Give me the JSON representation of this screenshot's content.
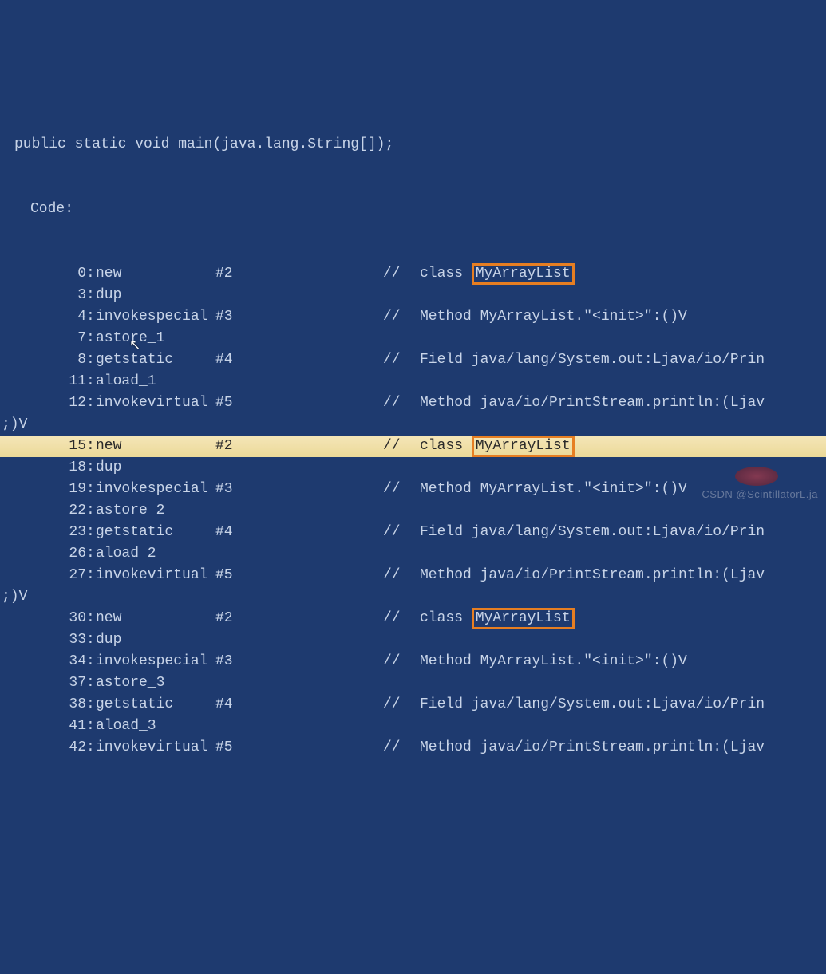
{
  "header": "public static void main(java.lang.String[]);",
  "code_label": "Code:",
  "edge_marker": ";)V",
  "watermark": "CSDN @ScintillatorL.ja",
  "lines": [
    {
      "pre": "",
      "offset": "0",
      "instr": "new",
      "arg": "#2",
      "sep": "//",
      "comment_prefix": "class ",
      "boxed": "MyArrayList",
      "comment_suffix": "",
      "hl": false
    },
    {
      "pre": "",
      "offset": "3",
      "instr": "dup",
      "arg": "",
      "sep": "",
      "comment_prefix": "",
      "boxed": "",
      "comment_suffix": "",
      "hl": false
    },
    {
      "pre": "",
      "offset": "4",
      "instr": "invokespecial",
      "arg": "#3",
      "sep": "//",
      "comment_prefix": "Method MyArrayList.\"<init>\":()V",
      "boxed": "",
      "comment_suffix": "",
      "hl": false
    },
    {
      "pre": "",
      "offset": "7",
      "instr": "astore_1",
      "arg": "",
      "sep": "",
      "comment_prefix": "",
      "boxed": "",
      "comment_suffix": "",
      "hl": false
    },
    {
      "pre": "",
      "offset": "8",
      "instr": "getstatic",
      "arg": "#4",
      "sep": "//",
      "comment_prefix": "Field java/lang/System.out:Ljava/io/Prin",
      "boxed": "",
      "comment_suffix": "",
      "hl": false
    },
    {
      "pre": "",
      "offset": "11",
      "instr": "aload_1",
      "arg": "",
      "sep": "",
      "comment_prefix": "",
      "boxed": "",
      "comment_suffix": "",
      "hl": false
    },
    {
      "pre": "",
      "offset": "12",
      "instr": "invokevirtual",
      "arg": "#5",
      "sep": "//",
      "comment_prefix": "Method java/io/PrintStream.println:(Ljav",
      "boxed": "",
      "comment_suffix": "",
      "hl": false
    },
    {
      "pre": ";)V",
      "offset": "",
      "instr": "",
      "arg": "",
      "sep": "",
      "comment_prefix": "",
      "boxed": "",
      "comment_suffix": "",
      "hl": false
    },
    {
      "pre": "",
      "offset": "15",
      "instr": "new",
      "arg": "#2",
      "sep": "//",
      "comment_prefix": "class ",
      "boxed": "MyArrayList",
      "comment_suffix": "",
      "hl": true
    },
    {
      "pre": "",
      "offset": "18",
      "instr": "dup",
      "arg": "",
      "sep": "",
      "comment_prefix": "",
      "boxed": "",
      "comment_suffix": "",
      "hl": false
    },
    {
      "pre": "",
      "offset": "19",
      "instr": "invokespecial",
      "arg": "#3",
      "sep": "//",
      "comment_prefix": "Method MyArrayList.\"<init>\":()V",
      "boxed": "",
      "comment_suffix": "",
      "hl": false
    },
    {
      "pre": "",
      "offset": "22",
      "instr": "astore_2",
      "arg": "",
      "sep": "",
      "comment_prefix": "",
      "boxed": "",
      "comment_suffix": "",
      "hl": false
    },
    {
      "pre": "",
      "offset": "23",
      "instr": "getstatic",
      "arg": "#4",
      "sep": "//",
      "comment_prefix": "Field java/lang/System.out:Ljava/io/Prin",
      "boxed": "",
      "comment_suffix": "",
      "hl": false
    },
    {
      "pre": "",
      "offset": "26",
      "instr": "aload_2",
      "arg": "",
      "sep": "",
      "comment_prefix": "",
      "boxed": "",
      "comment_suffix": "",
      "hl": false
    },
    {
      "pre": "",
      "offset": "27",
      "instr": "invokevirtual",
      "arg": "#5",
      "sep": "//",
      "comment_prefix": "Method java/io/PrintStream.println:(Ljav",
      "boxed": "",
      "comment_suffix": "",
      "hl": false
    },
    {
      "pre": ";)V",
      "offset": "",
      "instr": "",
      "arg": "",
      "sep": "",
      "comment_prefix": "",
      "boxed": "",
      "comment_suffix": "",
      "hl": false
    },
    {
      "pre": "",
      "offset": "30",
      "instr": "new",
      "arg": "#2",
      "sep": "//",
      "comment_prefix": "class ",
      "boxed": "MyArrayList",
      "comment_suffix": "",
      "hl": false
    },
    {
      "pre": "",
      "offset": "33",
      "instr": "dup",
      "arg": "",
      "sep": "",
      "comment_prefix": "",
      "boxed": "",
      "comment_suffix": "",
      "hl": false
    },
    {
      "pre": "",
      "offset": "34",
      "instr": "invokespecial",
      "arg": "#3",
      "sep": "//",
      "comment_prefix": "Method MyArrayList.\"<init>\":()V",
      "boxed": "",
      "comment_suffix": "",
      "hl": false
    },
    {
      "pre": "",
      "offset": "37",
      "instr": "astore_3",
      "arg": "",
      "sep": "",
      "comment_prefix": "",
      "boxed": "",
      "comment_suffix": "",
      "hl": false
    },
    {
      "pre": "",
      "offset": "38",
      "instr": "getstatic",
      "arg": "#4",
      "sep": "//",
      "comment_prefix": "Field java/lang/System.out:Ljava/io/Prin",
      "boxed": "",
      "comment_suffix": "",
      "hl": false
    },
    {
      "pre": "",
      "offset": "41",
      "instr": "aload_3",
      "arg": "",
      "sep": "",
      "comment_prefix": "",
      "boxed": "",
      "comment_suffix": "",
      "hl": false
    },
    {
      "pre": "",
      "offset": "42",
      "instr": "invokevirtual",
      "arg": "#5",
      "sep": "//",
      "comment_prefix": "Method java/io/PrintStream.println:(Ljav",
      "boxed": "",
      "comment_suffix": "",
      "hl": false
    }
  ]
}
